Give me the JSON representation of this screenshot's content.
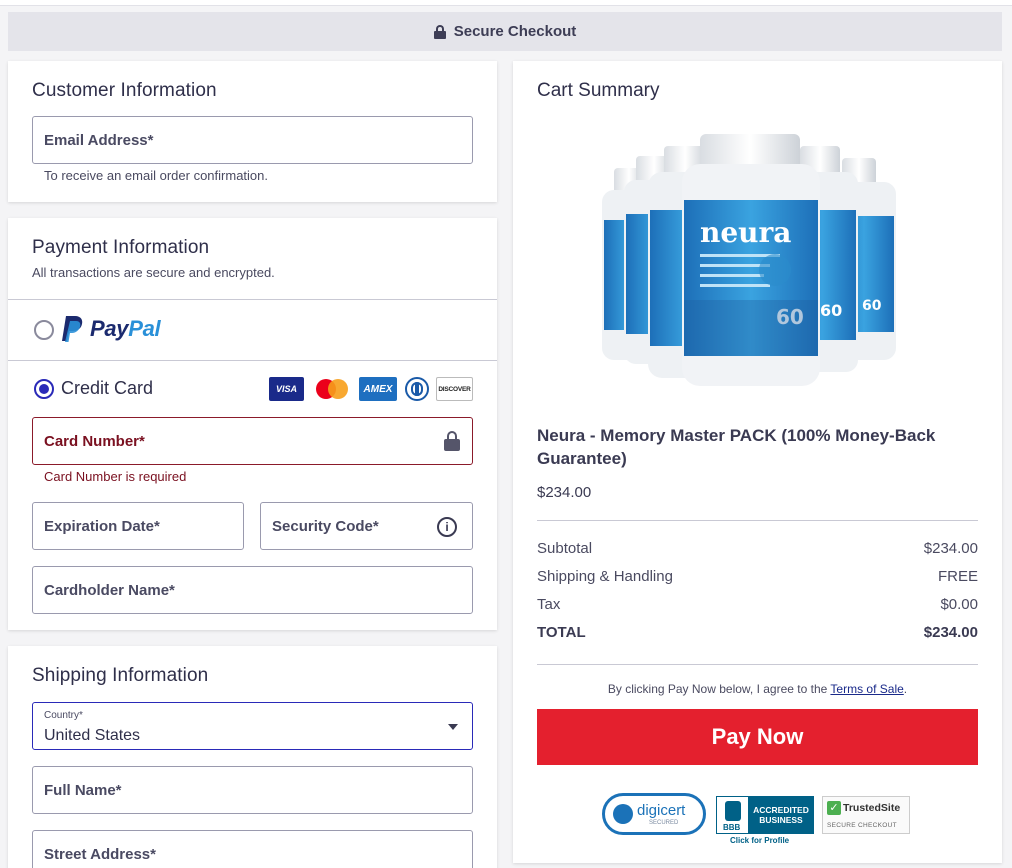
{
  "header": {
    "title": "Secure Checkout"
  },
  "customer": {
    "title": "Customer Information",
    "email_label": "Email Address*",
    "email_helper": "To receive an email order confirmation."
  },
  "payment": {
    "title": "Payment Information",
    "subtitle": "All transactions are secure and encrypted.",
    "paypal_label_1": "Pay",
    "paypal_label_2": "Pal",
    "credit_label": "Credit Card",
    "card_icons": [
      "VISA",
      "mastercard",
      "AMEX",
      "diners",
      "DISCOVER"
    ],
    "card_number_label": "Card Number*",
    "card_number_error": "Card Number is required",
    "expiration_label": "Expiration Date*",
    "security_label": "Security Code*",
    "cardholder_label": "Cardholder Name*"
  },
  "shipping": {
    "title": "Shipping Information",
    "country_label": "Country*",
    "country_value": "United States",
    "fullname_label": "Full Name*",
    "street_label": "Street Address*"
  },
  "cart": {
    "title": "Cart Summary",
    "product_brand": "neura",
    "bottle_count": "60",
    "product_name": "Neura - Memory Master PACK (100% Money-Back Guarantee)",
    "product_price": "$234.00",
    "rows": [
      {
        "label": "Subtotal",
        "value": "$234.00"
      },
      {
        "label": "Shipping & Handling",
        "value": "FREE"
      },
      {
        "label": "Tax",
        "value": "$0.00"
      },
      {
        "label": "TOTAL",
        "value": "$234.00"
      }
    ],
    "terms_prefix": "By clicking Pay Now below, I agree to the ",
    "terms_link": "Terms of Sale",
    "terms_suffix": ".",
    "pay_button": "Pay Now"
  },
  "badges": {
    "digicert": "digicert",
    "digicert_sub": "SECURED",
    "bbb_line1": "ACCREDITED",
    "bbb_line2": "BUSINESS",
    "bbb_click": "Click for Profile",
    "trusted": "TrustedSite",
    "trusted_sub": "SECURE CHECKOUT"
  },
  "colors": {
    "accent": "#2a2ab8",
    "pay": "#e4202e",
    "error": "#7a1020"
  }
}
